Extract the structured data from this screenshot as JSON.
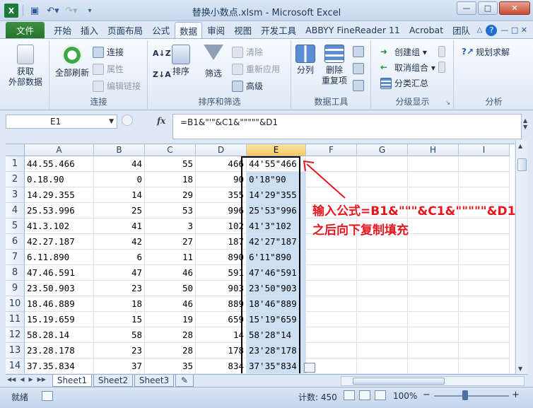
{
  "window": {
    "title": "替换小数点.xlsm - Microsoft Excel"
  },
  "qat": {
    "save_icon": "save-icon",
    "undo_icon": "undo-icon",
    "redo_icon": "redo-icon"
  },
  "tabs": [
    {
      "label": "文件"
    },
    {
      "label": "开始"
    },
    {
      "label": "插入"
    },
    {
      "label": "页面布局"
    },
    {
      "label": "公式"
    },
    {
      "label": "数据"
    },
    {
      "label": "审阅"
    },
    {
      "label": "视图"
    },
    {
      "label": "开发工具"
    },
    {
      "label": "ABBYY FineReader 11"
    },
    {
      "label": "Acrobat"
    },
    {
      "label": "团队"
    }
  ],
  "active_tab": "数据",
  "ribbon": {
    "get_external": {
      "line1": "获取",
      "line2": "外部数据"
    },
    "refresh_all": "全部刷新",
    "connections": "连接",
    "properties": "属性",
    "edit_links": "编辑链接",
    "group_connections": "连接",
    "sort": "排序",
    "filter": "筛选",
    "clear": "清除",
    "reapply": "重新应用",
    "advanced": "高级",
    "group_sort_filter": "排序和筛选",
    "text_to_columns": "分列",
    "remove_dup_1": "删除",
    "remove_dup_2": "重复项",
    "group_data_tools": "数据工具",
    "group": "创建组",
    "ungroup": "取消组合",
    "subtotal": "分类汇总",
    "group_outline": "分级显示",
    "solver": "规划求解",
    "group_analysis": "分析"
  },
  "formula_bar": {
    "name_box": "E1",
    "fx": "fx",
    "formula": "=B1&\"'\"&C1&\"\"\"\"\"&D1"
  },
  "columns": [
    "A",
    "B",
    "C",
    "D",
    "E",
    "F",
    "G",
    "H",
    "I"
  ],
  "rows": [
    {
      "n": "1",
      "a": "44.55.466",
      "b": "44",
      "c": "55",
      "d": "466",
      "e": "44'55\"466"
    },
    {
      "n": "2",
      "a": "0.18.90",
      "b": "0",
      "c": "18",
      "d": "90",
      "e": "0'18\"90"
    },
    {
      "n": "3",
      "a": "14.29.355",
      "b": "14",
      "c": "29",
      "d": "355",
      "e": "14'29\"355"
    },
    {
      "n": "4",
      "a": "25.53.996",
      "b": "25",
      "c": "53",
      "d": "996",
      "e": "25'53\"996"
    },
    {
      "n": "5",
      "a": "41.3.102",
      "b": "41",
      "c": "3",
      "d": "102",
      "e": "41'3\"102"
    },
    {
      "n": "6",
      "a": "42.27.187",
      "b": "42",
      "c": "27",
      "d": "187",
      "e": "42'27\"187"
    },
    {
      "n": "7",
      "a": "6.11.890",
      "b": "6",
      "c": "11",
      "d": "890",
      "e": "6'11\"890"
    },
    {
      "n": "8",
      "a": "47.46.591",
      "b": "47",
      "c": "46",
      "d": "591",
      "e": "47'46\"591"
    },
    {
      "n": "9",
      "a": "23.50.903",
      "b": "23",
      "c": "50",
      "d": "903",
      "e": "23'50\"903"
    },
    {
      "n": "10",
      "a": "18.46.889",
      "b": "18",
      "c": "46",
      "d": "889",
      "e": "18'46\"889"
    },
    {
      "n": "11",
      "a": "15.19.659",
      "b": "15",
      "c": "19",
      "d": "659",
      "e": "15'19\"659"
    },
    {
      "n": "12",
      "a": "58.28.14",
      "b": "58",
      "c": "28",
      "d": "14",
      "e": "58'28\"14"
    },
    {
      "n": "13",
      "a": "23.28.178",
      "b": "23",
      "c": "28",
      "d": "178",
      "e": "23'28\"178"
    },
    {
      "n": "14",
      "a": "37.35.834",
      "b": "37",
      "c": "35",
      "d": "834",
      "e": "37'35\"834"
    }
  ],
  "annotation": {
    "line1": "输入公式=B1&\"\"\"&C1&\"\"\"\"\"&D1",
    "line2": "之后向下复制填充"
  },
  "sheets": [
    {
      "label": "Sheet1"
    },
    {
      "label": "Sheet2"
    },
    {
      "label": "Sheet3"
    }
  ],
  "status": {
    "ready": "就绪",
    "count": "计数: 450",
    "zoom": "100%"
  },
  "colors": {
    "accent_file_tab": "#2e7d32",
    "selection_fill": "#cddff3",
    "annotation": "#e8161c"
  }
}
